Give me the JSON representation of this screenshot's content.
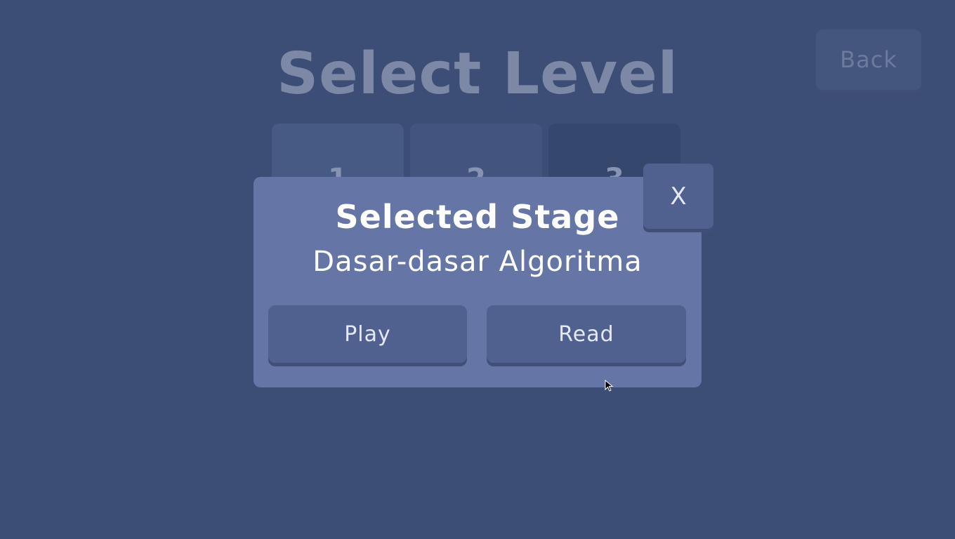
{
  "screen": {
    "title": "Select Level",
    "back_label": "Back"
  },
  "levels": [
    {
      "label": "1"
    },
    {
      "label": "2"
    },
    {
      "label": "3"
    }
  ],
  "modal": {
    "title": "Selected Stage",
    "stage_name": "Dasar-dasar Algoritma",
    "play_label": "Play",
    "read_label": "Read",
    "close_label": "X"
  },
  "colors": {
    "background": "#3c4e75",
    "modal": "#6475a6",
    "button": "#50618f"
  }
}
